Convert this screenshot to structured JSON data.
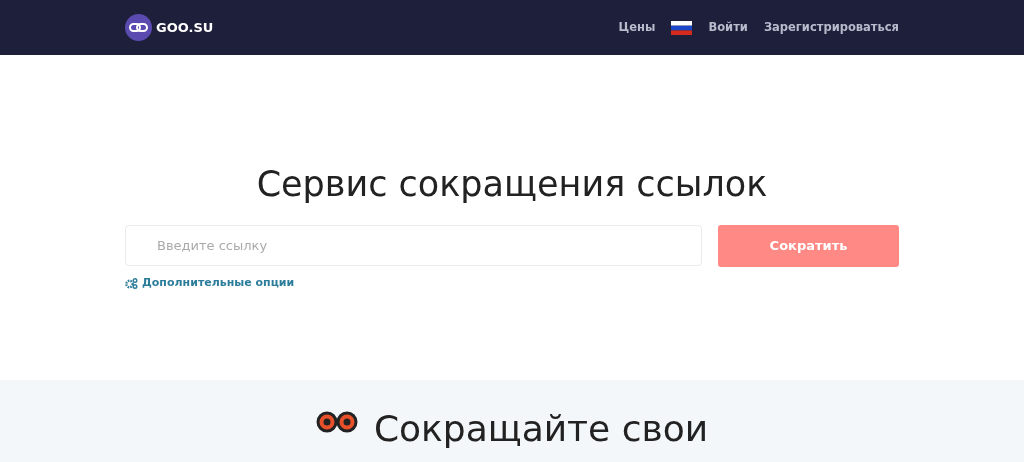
{
  "navbar": {
    "brand": "GOO.SU",
    "links": [
      {
        "label": "Цены",
        "kind": "link"
      },
      {
        "kind": "flag"
      },
      {
        "label": "Войти",
        "kind": "link"
      },
      {
        "label": "Зарегистрироваться",
        "kind": "link"
      }
    ]
  },
  "hero": {
    "title": "Сервис сокращения ссылок",
    "input": {
      "placeholder": "Введите ссылку"
    },
    "button": "Сократить",
    "options_link": "Дополнительные опции"
  },
  "section": {
    "title": "Сокращайте свои"
  }
}
